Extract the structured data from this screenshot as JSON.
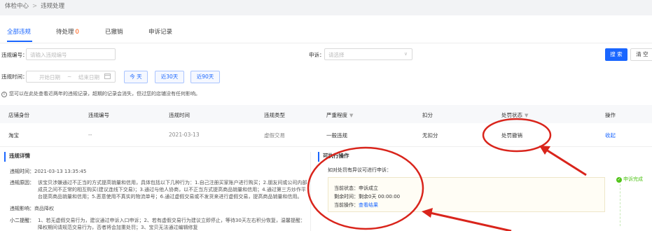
{
  "breadcrumb": {
    "root": "体检中心",
    "separator": ">",
    "current": "违规处理"
  },
  "tabs": [
    {
      "label": "全部违规",
      "count": ""
    },
    {
      "label": "待处理",
      "count": "0"
    },
    {
      "label": "已撤销",
      "count": ""
    },
    {
      "label": "申诉记录",
      "count": ""
    }
  ],
  "filters": {
    "violation_no_label": "违规编号：",
    "violation_no_placeholder": "请输入违规编号",
    "appeal_label": "申诉：",
    "appeal_placeholder": "请选择",
    "time_label": "违规时间：",
    "start_placeholder": "开始日期",
    "end_placeholder": "结束日期",
    "date_sep": "~",
    "quick_today": "今 天",
    "quick_30": "近30天",
    "quick_90": "近90天",
    "search_button": "搜 索",
    "clear_button": "清 空"
  },
  "notice": "您可以在此处查看近两年的违规记录，超期的记录会消失，但过您的店铺没有任何影响。",
  "table": {
    "headers": [
      "店铺身份",
      "违规编号",
      "违规时间",
      "违规类型",
      "严重程度",
      "扣分",
      "处罚状态",
      "操作"
    ],
    "row": [
      "淘宝",
      "--",
      "2021-03-13",
      "虚假交易",
      "一般违规",
      "无扣分",
      "处罚撤销",
      "收起"
    ]
  },
  "detail": {
    "title": "违规详情",
    "time_key": "违规时间：",
    "time_value": "2021-03-13 13:35:45",
    "reason_key": "违规原因：",
    "reason_value_1": "该宝贝涉嫌通过不正当的方式提高销量和信用，具体包括以下几种行为：1.自己注册买家账户进行购买；2.朋友间或公司内部",
    "reason_value_2": "成员之间不正常的相互购买(建议连线下交易)；3.通过与他人协商，以不正当方式提高商品销量和信用；4.通过第三方炒作平",
    "reason_value_3": "台提高商品销量和信用；5.恶意使用不真实的物流单号；6.通过虚假交易或不发货来进行虚假交易，提高商品销量和信用。",
    "impact_key": "违规影响：",
    "impact_value": "商品降权",
    "tip_key": "小二提醒：",
    "tip_value_1": "1、若无虚假交易行为，建议通过申诉入口申诉；2、若有虚假交易行为建议立即停止，等待30天左右积分恢复，温馨提醒：",
    "tip_value_2": "降权期间请规范交易行为，否者将会加重处罚；3、宝贝无法通过编辑修复"
  },
  "operations": {
    "title": "可执行操作",
    "question": "如对处罚有异议可进行申诉：",
    "status_key": "当前状态：",
    "status_value": "申诉成立",
    "remain_key": "剩余时间：",
    "remain_value": "剩余0天 00:00:00",
    "op_key": "当前操作：",
    "op_value": "查看结果",
    "done_label": "申诉完成"
  },
  "colors": {
    "accent": "#1a66ff",
    "annotation": "#d9241b",
    "success": "#52c41a",
    "warning": "#ff5000"
  }
}
